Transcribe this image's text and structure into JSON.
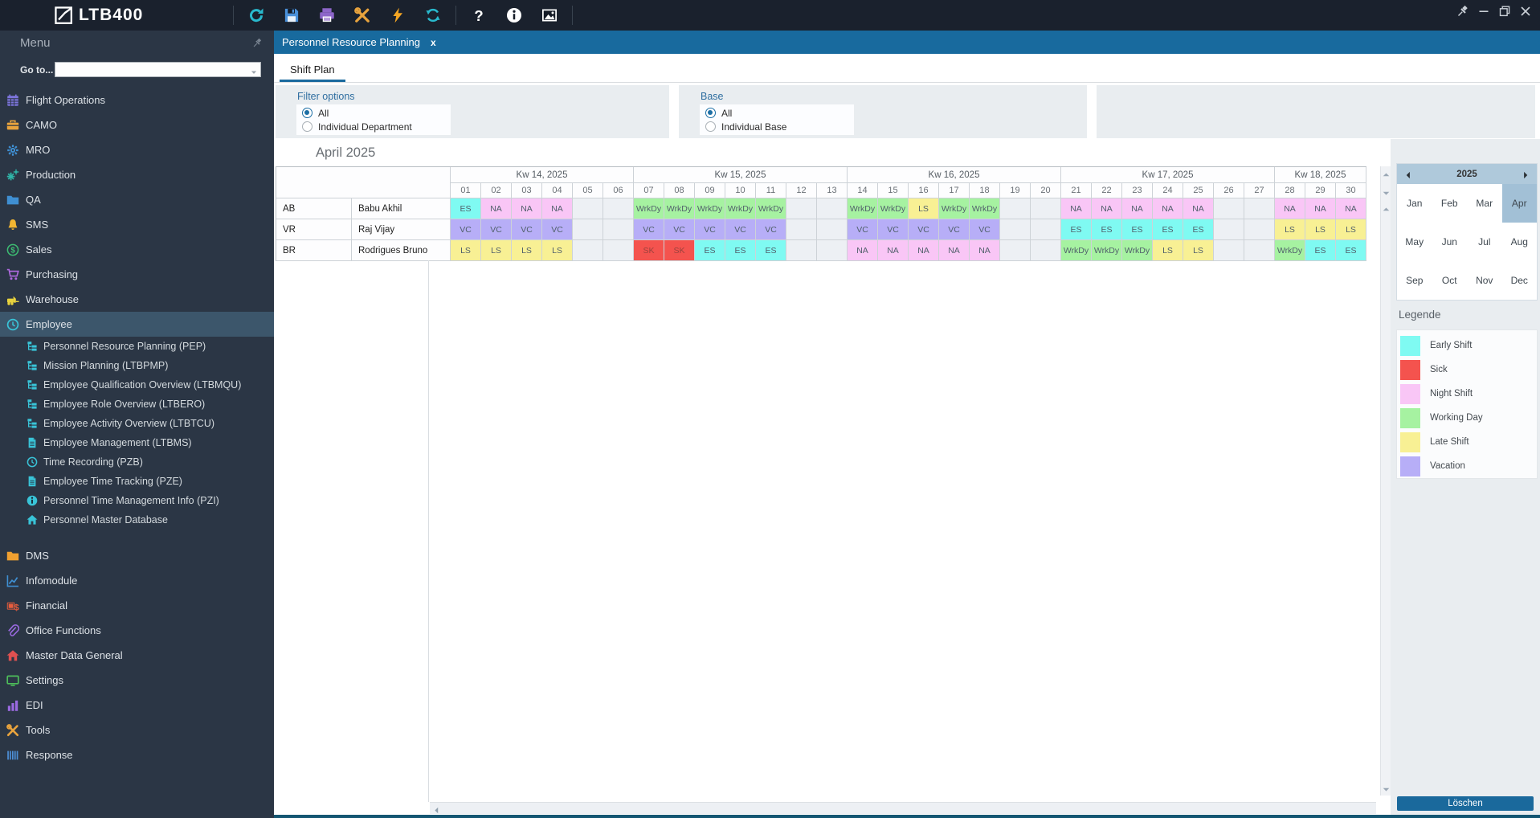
{
  "topbar": {
    "logo": "LTB400",
    "tool_icons": [
      {
        "icon": "refresh",
        "color": "#29b9cd"
      },
      {
        "icon": "save",
        "color": "#4a90d9"
      },
      {
        "icon": "print",
        "color": "#8d66c9"
      },
      {
        "icon": "tools",
        "color": "#e8a33d"
      },
      {
        "icon": "lightning",
        "color": "#f5a623"
      },
      {
        "icon": "sync",
        "color": "#29b9cd"
      },
      {
        "icon": "help",
        "color": "#ffffff"
      },
      {
        "icon": "info",
        "color": "#ffffff"
      },
      {
        "icon": "image",
        "color": "#ffffff"
      }
    ],
    "window_controls": [
      "pin",
      "minimize",
      "restore",
      "close"
    ]
  },
  "sidebar": {
    "menu_label": "Menu",
    "goto_label": "Go to...",
    "items": [
      {
        "label": "Flight Operations",
        "icon": "calendar",
        "color": "#7d75dd"
      },
      {
        "label": "CAMO",
        "icon": "briefcase",
        "color": "#e8a33d"
      },
      {
        "label": "MRO",
        "icon": "gear",
        "color": "#3f8fd2"
      },
      {
        "label": "Production",
        "icon": "gears",
        "color": "#2fb5a8"
      },
      {
        "label": "QA",
        "icon": "folder",
        "color": "#3f8fd2"
      },
      {
        "label": "SMS",
        "icon": "bell",
        "color": "#f2b632"
      },
      {
        "label": "Sales",
        "icon": "dollar-circle",
        "color": "#3dbd72"
      },
      {
        "label": "Purchasing",
        "icon": "cart",
        "color": "#b06ae0"
      },
      {
        "label": "Warehouse",
        "icon": "forklift",
        "color": "#e8d23d"
      },
      {
        "label": "Employee",
        "icon": "clock",
        "color": "#39c4d8",
        "selected": true,
        "children": [
          {
            "label": "Personnel Resource Planning (PEP)",
            "icon": "org"
          },
          {
            "label": "Mission Planning (LTBPMP)",
            "icon": "org"
          },
          {
            "label": "Employee Qualification Overview (LTBMQU)",
            "icon": "org"
          },
          {
            "label": "Employee Role Overview (LTBERO)",
            "icon": "org"
          },
          {
            "label": "Employee Activity Overview (LTBTCU)",
            "icon": "org"
          },
          {
            "label": "Employee Management (LTBMS)",
            "icon": "document"
          },
          {
            "label": "Time Recording (PZB)",
            "icon": "clock"
          },
          {
            "label": "Employee Time Tracking (PZE)",
            "icon": "document"
          },
          {
            "label": "Personnel Time Management Info (PZI)",
            "icon": "info"
          },
          {
            "label": "Personnel Master Database",
            "icon": "home"
          }
        ]
      },
      {
        "label": "DMS",
        "icon": "folder",
        "color": "#f0a030"
      },
      {
        "label": "Infomodule",
        "icon": "line-chart",
        "color": "#3f8fd2"
      },
      {
        "label": "Financial",
        "icon": "money",
        "color": "#e85d3d"
      },
      {
        "label": "Office Functions",
        "icon": "paperclip",
        "color": "#9a6ae0"
      },
      {
        "label": "Master Data General",
        "icon": "home",
        "color": "#e05050"
      },
      {
        "label": "Settings",
        "icon": "monitor",
        "color": "#4dbd5a"
      },
      {
        "label": "EDI",
        "icon": "bar-chart",
        "color": "#9a6ae0"
      },
      {
        "label": "Tools",
        "icon": "tools",
        "color": "#e8a33d"
      },
      {
        "label": "Response",
        "icon": "barcode",
        "color": "#4d8fd6"
      }
    ],
    "submenu_color": "#39c4d8"
  },
  "tab": {
    "title": "Personnel Resource Planning",
    "subtab": "Shift Plan"
  },
  "filters": {
    "filter_options": {
      "title": "Filter options",
      "options": [
        "All",
        "Individual Department"
      ],
      "selected": "All"
    },
    "base": {
      "title": "Base",
      "options": [
        "All",
        "Individual Base"
      ],
      "selected": "All"
    }
  },
  "schedule": {
    "month_title": "April 2025",
    "weeks": [
      {
        "label": "Kw 14, 2025",
        "days": [
          "01",
          "02",
          "03",
          "04",
          "05",
          "06"
        ]
      },
      {
        "label": "Kw 15, 2025",
        "days": [
          "07",
          "08",
          "09",
          "10",
          "11",
          "12",
          "13"
        ]
      },
      {
        "label": "Kw 16, 2025",
        "days": [
          "14",
          "15",
          "16",
          "17",
          "18",
          "19",
          "20"
        ]
      },
      {
        "label": "Kw 17, 2025",
        "days": [
          "21",
          "22",
          "23",
          "24",
          "25",
          "26",
          "27"
        ]
      },
      {
        "label": "Kw 18, 2025",
        "days": [
          "28",
          "29",
          "30"
        ]
      }
    ],
    "weekend_days": [
      "05",
      "06",
      "12",
      "13",
      "19",
      "20",
      "26",
      "27"
    ],
    "rows": [
      {
        "code": "AB",
        "name": "Babu Akhil",
        "cells": [
          "ES",
          "NA",
          "NA",
          "NA",
          "",
          "",
          "WrkDy",
          "WrkDy",
          "WrkDy",
          "WrkDy",
          "WrkDy",
          "",
          "",
          "WrkDy",
          "WrkDy",
          "LS",
          "WrkDy",
          "WrkDy",
          "",
          "",
          "NA",
          "NA",
          "NA",
          "NA",
          "NA",
          "",
          "",
          "NA",
          "NA",
          "NA"
        ]
      },
      {
        "code": "VR",
        "name": "Raj Vijay",
        "cells": [
          "VC",
          "VC",
          "VC",
          "VC",
          "",
          "",
          "VC",
          "VC",
          "VC",
          "VC",
          "VC",
          "",
          "",
          "VC",
          "VC",
          "VC",
          "VC",
          "VC",
          "",
          "",
          "ES",
          "ES",
          "ES",
          "ES",
          "ES",
          "",
          "",
          "LS",
          "LS",
          "LS"
        ]
      },
      {
        "code": "BR",
        "name": "Rodrigues Bruno",
        "cells": [
          "LS",
          "LS",
          "LS",
          "LS",
          "",
          "",
          "SK",
          "SK",
          "ES",
          "ES",
          "ES",
          "",
          "",
          "NA",
          "NA",
          "NA",
          "NA",
          "NA",
          "",
          "",
          "WrkDy",
          "WrkDy",
          "WrkDy",
          "LS",
          "LS",
          "",
          "",
          "WrkDy",
          "ES",
          "ES"
        ]
      }
    ]
  },
  "shift_types": {
    "ES": {
      "label": "Early Shift",
      "bg": "#7ffaf2"
    },
    "SK": {
      "label": "Sick",
      "bg": "#f4534e"
    },
    "NA": {
      "label": "Night Shift",
      "bg": "#f9c6f6"
    },
    "WrkDy": {
      "label": "Working Day",
      "bg": "#a6f2a1"
    },
    "LS": {
      "label": "Late Shift",
      "bg": "#f8f094"
    },
    "VC": {
      "label": "Vacation",
      "bg": "#b7aef7"
    }
  },
  "month_picker": {
    "year": "2025",
    "months": [
      "Jan",
      "Feb",
      "Mar",
      "Apr",
      "May",
      "Jun",
      "Jul",
      "Aug",
      "Sep",
      "Oct",
      "Nov",
      "Dec"
    ],
    "selected": "Apr"
  },
  "legend": {
    "title": "Legende",
    "order": [
      "ES",
      "SK",
      "NA",
      "WrkDy",
      "LS",
      "VC"
    ]
  },
  "actions": {
    "delete_label": "Löschen"
  }
}
